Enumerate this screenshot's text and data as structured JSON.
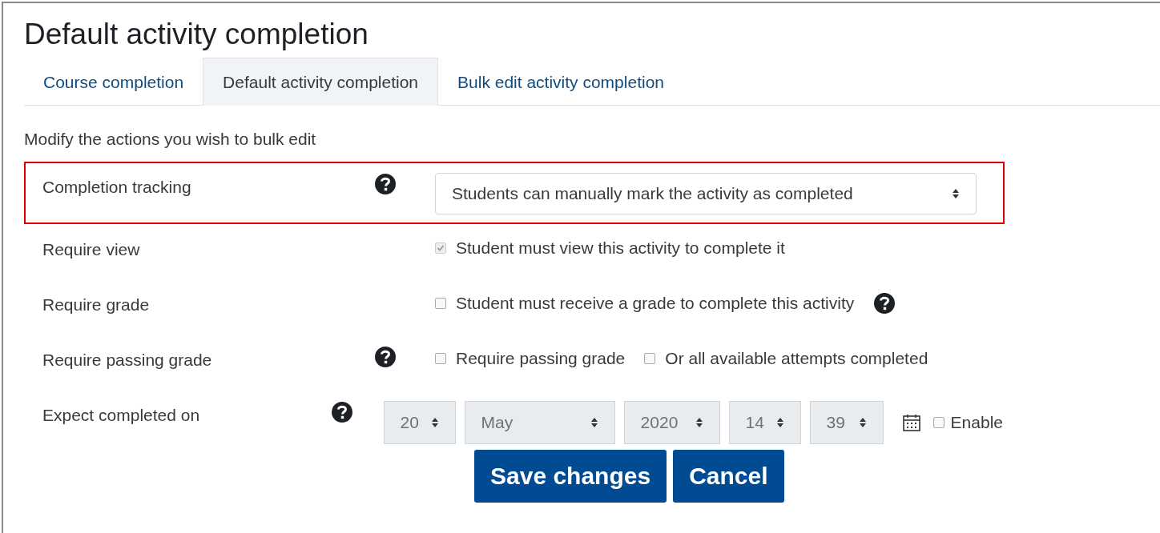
{
  "title": "Default activity completion",
  "tabs": [
    {
      "label": "Course completion",
      "selected": false
    },
    {
      "label": "Default activity completion",
      "selected": true
    },
    {
      "label": "Bulk edit activity completion",
      "selected": false
    }
  ],
  "intro": "Modify the actions you wish to bulk edit",
  "rows": [
    {
      "kind": "select",
      "label": "Completion tracking",
      "help": true,
      "highlighted": true,
      "value": "Students can manually mark the activity as completed"
    },
    {
      "kind": "checkboxes",
      "label": "Require view",
      "help": false,
      "highlighted": false,
      "options": [
        {
          "label": "Student must view this activity to complete it",
          "checked": true,
          "disabled": true
        }
      ]
    },
    {
      "kind": "checkboxes",
      "label": "Require grade",
      "help": false,
      "highlighted": false,
      "trailing_help": true,
      "options": [
        {
          "label": "Student must receive a grade to complete this activity",
          "checked": false,
          "disabled": false
        }
      ]
    },
    {
      "kind": "checkboxes",
      "label": "Require passing grade",
      "help": true,
      "highlighted": false,
      "options": [
        {
          "label": "Require passing grade",
          "checked": false,
          "disabled": false
        },
        {
          "label": "Or all available attempts completed",
          "checked": false,
          "disabled": false
        }
      ]
    },
    {
      "kind": "date",
      "label": "Expect completed on",
      "help": true,
      "highlighted": false,
      "disabled": true,
      "fields": [
        "20",
        "May",
        "2020",
        "14",
        "39"
      ],
      "enable": {
        "label": "Enable",
        "checked": false
      }
    }
  ],
  "buttons": [
    {
      "label": "Save changes"
    },
    {
      "label": "Cancel"
    }
  ]
}
